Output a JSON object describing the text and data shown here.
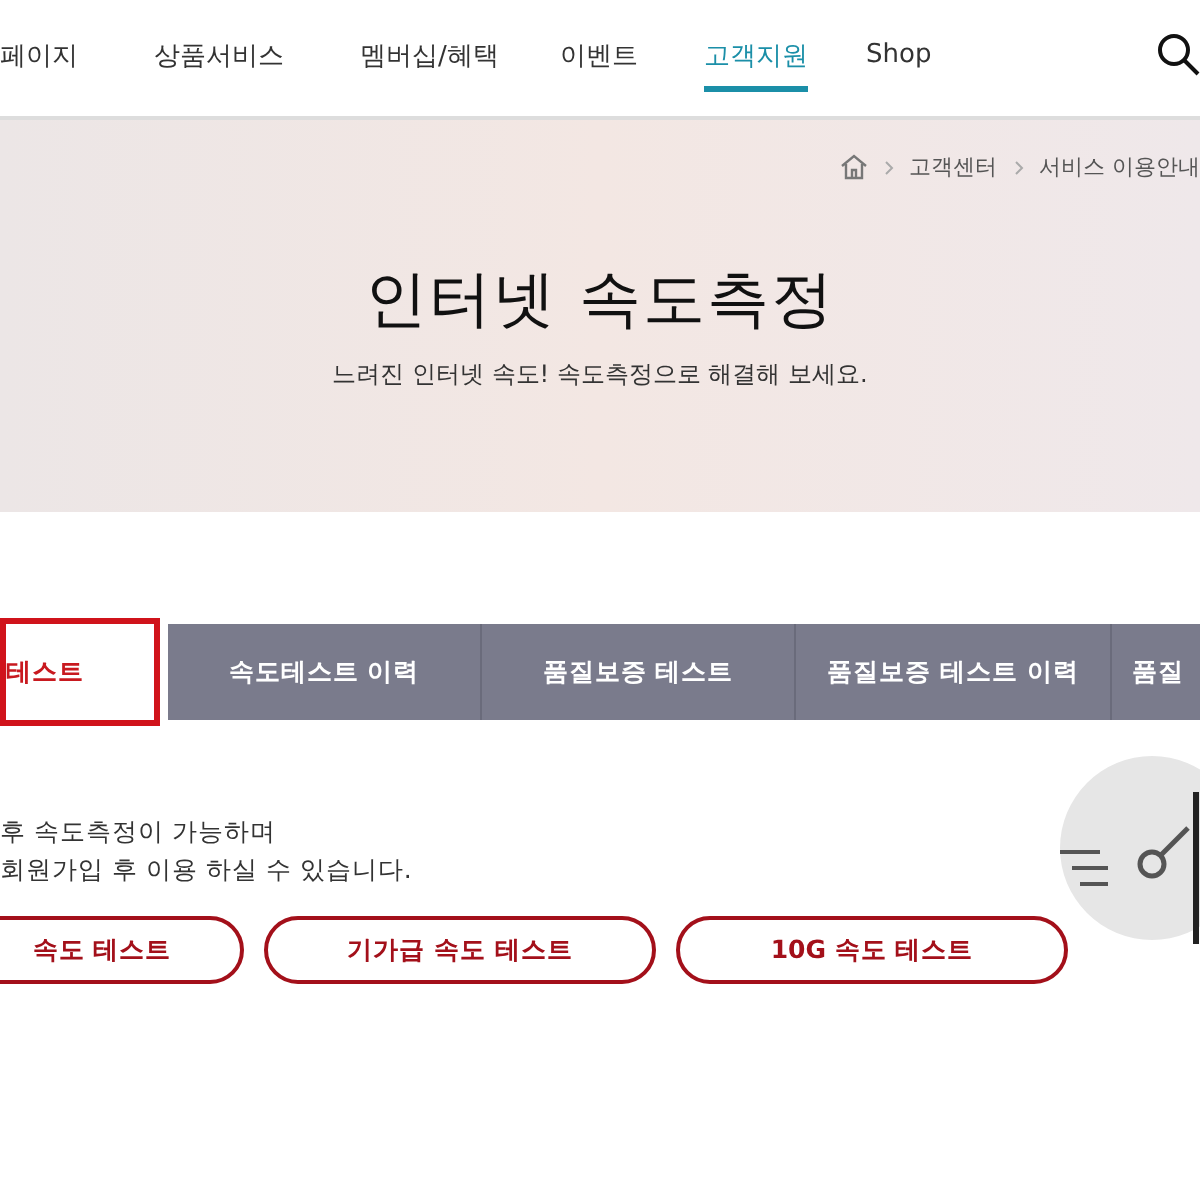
{
  "nav": {
    "items": [
      {
        "label": "페이지",
        "selected": false
      },
      {
        "label": "상품서비스",
        "selected": false
      },
      {
        "label": "멤버십/혜택",
        "selected": false
      },
      {
        "label": "이벤트",
        "selected": false
      },
      {
        "label": "고객지원",
        "selected": true
      },
      {
        "label": "Shop",
        "selected": false
      }
    ]
  },
  "breadcrumb": [
    "고객센터",
    "서비스 이용안내"
  ],
  "hero": {
    "title": "인터넷 속도측정",
    "subtitle": "느려진 인터넷 속도! 속도측정으로 해결해 보세요."
  },
  "tabs": [
    {
      "label": "테스트",
      "selected": true
    },
    {
      "label": "속도테스트 이력",
      "selected": false
    },
    {
      "label": "품질보증 테스트",
      "selected": false
    },
    {
      "label": "품질보증 테스트 이력",
      "selected": false
    },
    {
      "label": "품질",
      "selected": false
    }
  ],
  "notice": [
    "후 속도측정이 가능하며",
    "회원가입 후 이용 하실 수 있습니다."
  ],
  "test_buttons": [
    "속도 테스트",
    "기가급 속도 테스트",
    "10G 속도 테스트"
  ]
}
